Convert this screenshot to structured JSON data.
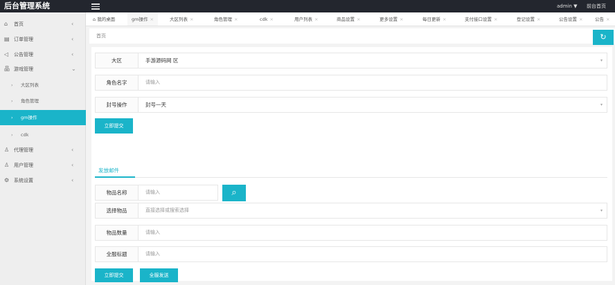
{
  "app": {
    "title": "后台管理系统",
    "user": "admin ▼",
    "front_link": "前台首页"
  },
  "sidebar": {
    "items": [
      {
        "icon": "home-icon",
        "glyph": "⌂",
        "label": "首页",
        "arrow": "‹"
      },
      {
        "icon": "order-icon",
        "glyph": "▤",
        "label": "订单管理",
        "arrow": "‹"
      },
      {
        "icon": "speaker-icon",
        "glyph": "◁",
        "label": "公告管理",
        "arrow": "‹"
      },
      {
        "icon": "sitemap-icon",
        "glyph": "品",
        "label": "游戏管理",
        "arrow": "⌄"
      }
    ],
    "subitems": [
      {
        "label": "大区列表"
      },
      {
        "label": "角色管理"
      },
      {
        "label": "gm操作"
      },
      {
        "label": "cdk"
      }
    ],
    "items_after": [
      {
        "icon": "agent-icon",
        "glyph": "♙",
        "label": "代理管理",
        "arrow": "‹"
      },
      {
        "icon": "user-icon",
        "glyph": "♙",
        "label": "用户管理",
        "arrow": "‹"
      },
      {
        "icon": "gear-icon",
        "glyph": "⚙",
        "label": "系统设置",
        "arrow": "‹"
      }
    ]
  },
  "tabs": [
    {
      "label": "⌂ 我的桌面"
    },
    {
      "label": "gm操作"
    },
    {
      "label": "大区列表"
    },
    {
      "label": "角色管理"
    },
    {
      "label": "cdk"
    },
    {
      "label": "用户列表"
    },
    {
      "label": "商品设置"
    },
    {
      "label": "更多设置"
    },
    {
      "label": "每日更新"
    },
    {
      "label": "支付接口设置"
    },
    {
      "label": "登记设置"
    },
    {
      "label": "公告设置"
    },
    {
      "label": "公告"
    }
  ],
  "breadcrumb": {
    "text": "首页"
  },
  "refresh_glyph": "↻",
  "form1": {
    "region_label": "大区",
    "region_value": "手游源码网  区",
    "role_label": "角色名字",
    "role_placeholder": "请输入",
    "ban_label": "封号操作",
    "ban_value": "封号一天",
    "submit": "立即提交"
  },
  "subtab": {
    "label": "发放邮件"
  },
  "form2": {
    "item_name_label": "物品名称",
    "item_name_placeholder": "请输入",
    "search_glyph": "⌕",
    "select_item_label": "选择物品",
    "select_item_placeholder": "直接选择或搜索选择",
    "quantity_label": "物品数量",
    "quantity_placeholder": "请输入",
    "title_label": "全服标题",
    "title_placeholder": "请输入",
    "submit": "立即提交",
    "send_all": "全服发送"
  },
  "dropdown_glyph": "▾",
  "close_glyph": "×"
}
